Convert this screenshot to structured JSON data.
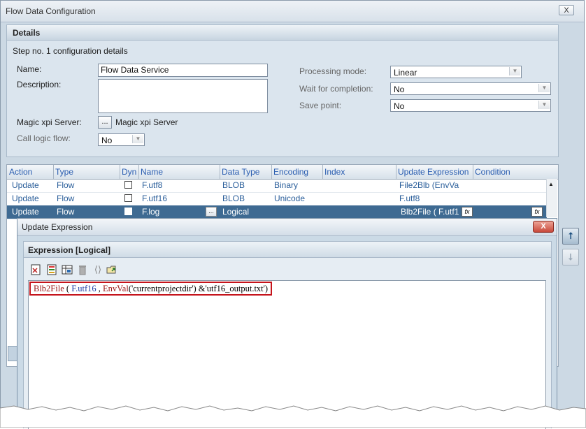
{
  "window": {
    "title": "Flow Data Configuration",
    "close_label": "X"
  },
  "details": {
    "header": "Details",
    "step_text": "Step no. 1 configuration details",
    "name_label": "Name:",
    "name_value": "Flow Data Service",
    "description_label": "Description:",
    "description_value": "",
    "server_label": "Magic xpi Server:",
    "server_button": "...",
    "server_value": "Magic xpi Server",
    "call_logic_label": "Call logic flow:",
    "call_logic_value": "No",
    "processing_mode_label": "Processing mode:",
    "processing_mode_value": "Linear",
    "wait_label": "Wait for completion:",
    "wait_value": "No",
    "save_point_label": "Save point:",
    "save_point_value": "No"
  },
  "grid": {
    "columns": [
      "Action",
      "Type",
      "Dyn",
      "Name",
      "Data Type",
      "Encoding",
      "Index",
      "Update Expression",
      "Condition"
    ],
    "rows": [
      {
        "action": "Update",
        "type": "Flow",
        "name": "F.utf8",
        "data_type": "BLOB",
        "encoding": "Binary",
        "index": "",
        "update_expression": "File2Blb (EnvVa",
        "condition": ""
      },
      {
        "action": "Update",
        "type": "Flow",
        "name": "F.utf16",
        "data_type": "BLOB",
        "encoding": "Unicode",
        "index": "",
        "update_expression": "F.utf8",
        "condition": ""
      },
      {
        "action": "Update",
        "type": "Flow",
        "name": "F.log",
        "data_type": "Logical",
        "encoding": "",
        "index": "",
        "update_expression": "Blb2File ( F.utf1",
        "condition": ""
      }
    ],
    "fx_label": "fx",
    "dots_label": "..."
  },
  "side_buttons": {
    "up_label": "⭡",
    "down_label": "⭣"
  },
  "dialog": {
    "title": "Update Expression",
    "close_label": "X",
    "panel_header": "Expression [Logical]",
    "toolbar": [
      "expression-check-icon",
      "function-list-icon",
      "variables-icon",
      "trash-icon",
      "brackets-icon",
      "open-folder-icon"
    ],
    "expression": {
      "fn1": "Blb2File",
      "p1": " ( ",
      "var1": "F.utf16",
      "p2": " , ",
      "fn2": "EnvVal",
      "p3": "('currentprojectdir') &'utf16_output.txt')"
    }
  },
  "colors": {
    "accent": "#3e6a92",
    "highlight_border": "#c5141c",
    "dialog_close": "#c8483a"
  }
}
